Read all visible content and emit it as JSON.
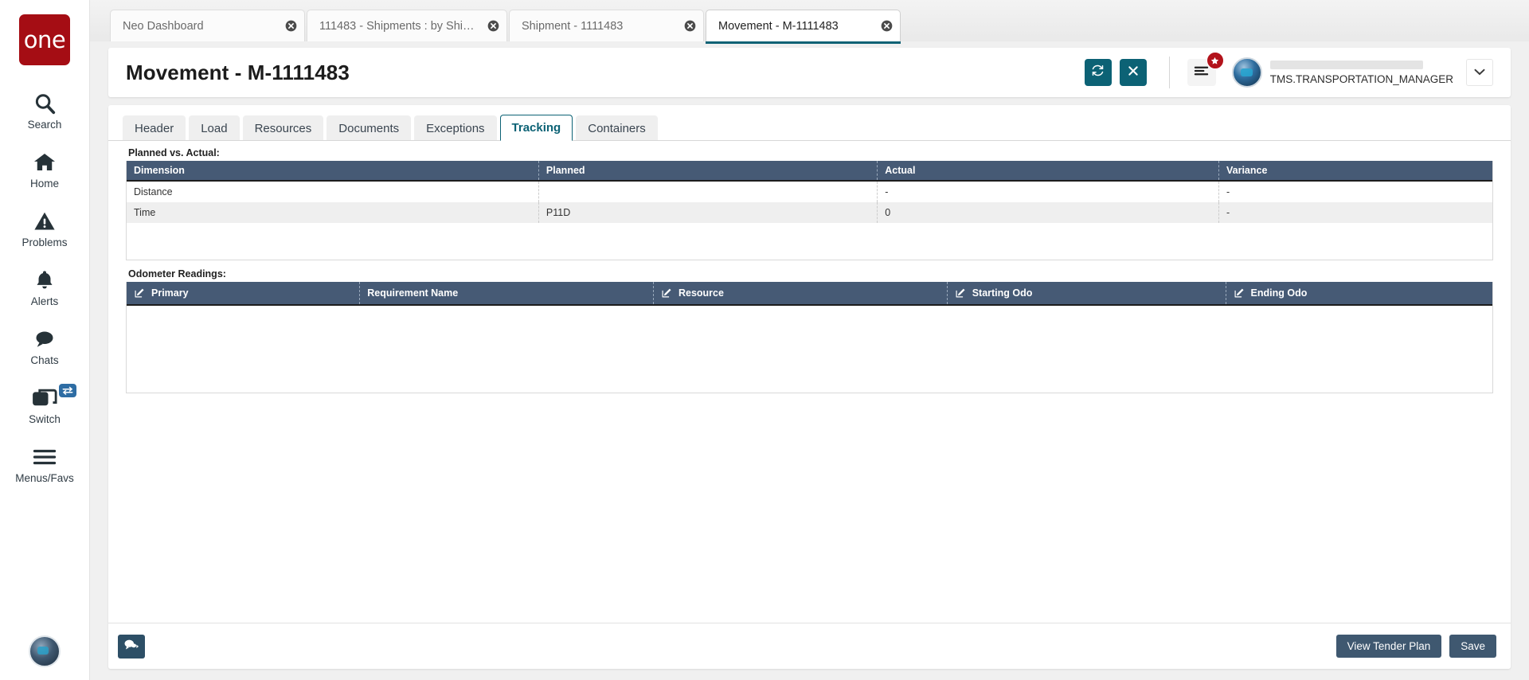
{
  "sidebar": {
    "logo_text": "one",
    "items": [
      {
        "label": "Search",
        "icon": "search-icon"
      },
      {
        "label": "Home",
        "icon": "home-icon"
      },
      {
        "label": "Problems",
        "icon": "warning-triangle-icon"
      },
      {
        "label": "Alerts",
        "icon": "bell-icon"
      },
      {
        "label": "Chats",
        "icon": "chat-bubble-icon"
      },
      {
        "label": "Switch",
        "icon": "windows-stack-icon"
      },
      {
        "label": "Menus/Favs",
        "icon": "hamburger-icon"
      }
    ]
  },
  "browser_tabs": [
    {
      "title": "Neo Dashboard",
      "active": false
    },
    {
      "title": "111483 - Shipments : by Shipme...",
      "active": false
    },
    {
      "title": "Shipment - 1111483",
      "active": false
    },
    {
      "title": "Movement - M-1111483",
      "active": true
    }
  ],
  "header": {
    "title": "Movement - M-1111483",
    "refresh_icon": "refresh-icon",
    "close_icon": "close-icon",
    "menu_icon": "hamburger-icon",
    "badge_icon": "star-icon",
    "user_name": "TMS.TRANSPORTATION_MANAGER",
    "caret_icon": "chevron-down-icon"
  },
  "tabs": [
    {
      "label": "Header",
      "active": false
    },
    {
      "label": "Load",
      "active": false
    },
    {
      "label": "Resources",
      "active": false
    },
    {
      "label": "Documents",
      "active": false
    },
    {
      "label": "Exceptions",
      "active": false
    },
    {
      "label": "Tracking",
      "active": true
    },
    {
      "label": "Containers",
      "active": false
    }
  ],
  "planned_vs_actual": {
    "label": "Planned vs. Actual:",
    "columns": [
      "Dimension",
      "Planned",
      "Actual",
      "Variance"
    ],
    "rows": [
      {
        "dimension": "Distance",
        "planned": "",
        "actual": "-",
        "variance": "-"
      },
      {
        "dimension": "Time",
        "planned": "P11D",
        "actual": "0",
        "variance": "-"
      }
    ]
  },
  "odometer_readings": {
    "label": "Odometer Readings:",
    "columns": [
      {
        "label": "Primary",
        "editable": true
      },
      {
        "label": "Requirement Name",
        "editable": false
      },
      {
        "label": "Resource",
        "editable": true
      },
      {
        "label": "Starting Odo",
        "editable": true
      },
      {
        "label": "Ending Odo",
        "editable": true
      }
    ],
    "rows": []
  },
  "footer": {
    "chat_icon": "chat-bubbles-icon",
    "view_tender_plan_label": "View Tender Plan",
    "save_label": "Save"
  },
  "colors": {
    "brand_red": "#a50d14",
    "teal": "#0c6275",
    "grid_header": "#465a75",
    "button_slate": "#3f5870",
    "badge_red": "#b3131b"
  }
}
